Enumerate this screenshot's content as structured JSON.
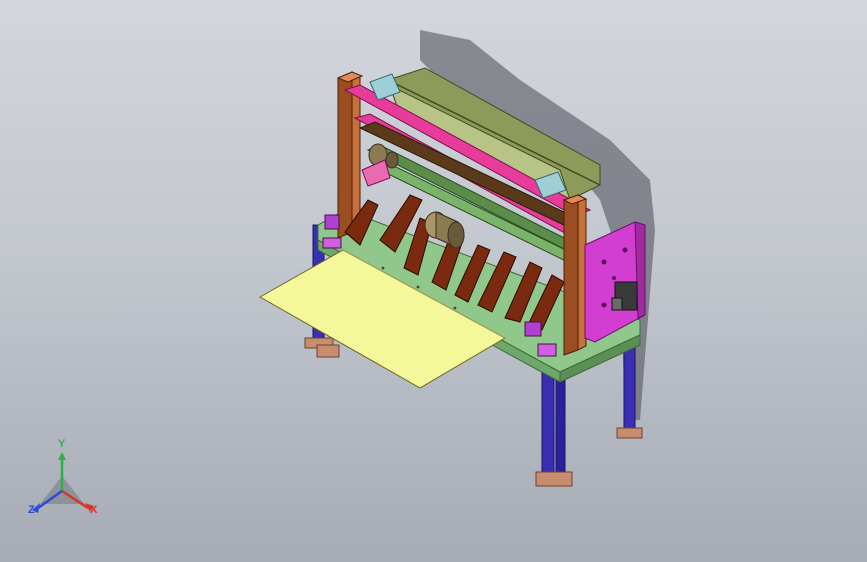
{
  "viewport": {
    "background_top": "#d3d6dc",
    "background_bottom": "#a6abb5"
  },
  "model": {
    "colors": {
      "frame_leg": "#3a2fb3",
      "frame_leg_dark": "#221a7a",
      "foot_plate": "#c98c6e",
      "base_green": "#8fc88a",
      "hopper_olive": "#8e9a5a",
      "hopper_olive_light": "#b8c486",
      "upright_brown": "#9a4e22",
      "top_bracket": "#9fcfd6",
      "side_plate_magenta": "#d23fd0",
      "beam_pink": "#e83c9a",
      "blade_brown": "#7a2a0e",
      "tray_yellow": "#f4f79a",
      "cylinder_tan": "#8c7a52",
      "shaft_green": "#5a8c4a",
      "shadow": "#3a3d44"
    }
  },
  "triad": {
    "y_label": "Y",
    "x_label": "X",
    "z_label": "Z",
    "y_color": "#2bb34a",
    "x_color": "#d9342b",
    "z_color": "#2b4bd9"
  }
}
